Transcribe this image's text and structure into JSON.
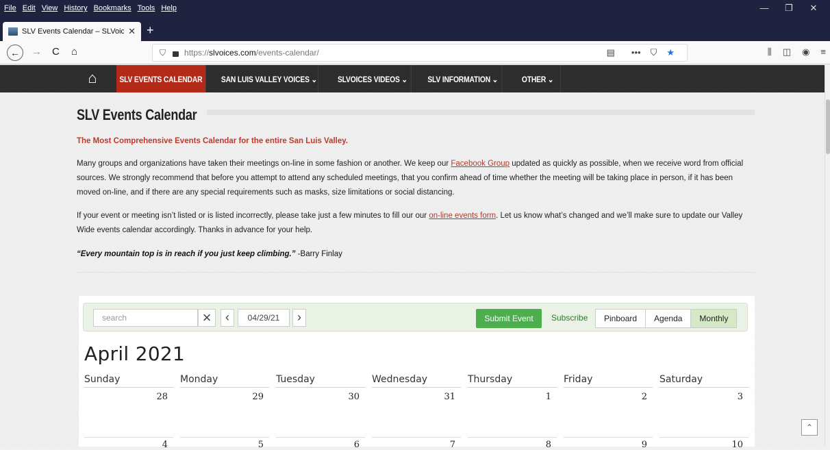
{
  "browser": {
    "menu": [
      "File",
      "Edit",
      "View",
      "History",
      "Bookmarks",
      "Tools",
      "Help"
    ],
    "window_controls": [
      "—",
      "❐",
      "✕"
    ],
    "tab_title": "SLV Events Calendar – SLVoices",
    "url_prefix": "https://",
    "url_host": "slvoices.com",
    "url_path": "/events-calendar/"
  },
  "site_nav": {
    "items": [
      "SLV EVENTS CALENDAR ⌄",
      "SAN LUIS VALLEY VOICES ⌄",
      "SLVOICES VIDEOS ⌄",
      "SLV INFORMATION ⌄",
      "OTHER ⌄"
    ]
  },
  "page": {
    "title": "SLV Events Calendar",
    "tagline": "The Most Comprehensive Events Calendar for the entire San Luis Valley.",
    "p1_a": "Many groups and organizations have taken their meetings on-line in some fashion or another. We keep our ",
    "p1_link": "Facebook Group",
    "p1_b": " updated as quickly as possible, when we receive word from official sources. We strongly recommend that before you attempt to attend any scheduled meetings, that you confirm ahead of time whether the meeting will be taking place in person, if it has been moved on-line, and if there are any special requirements such as masks, size limitations or social distancing.",
    "p2_a": "If your event or meeting isn’t listed or is listed incorrectly, please take just a few minutes to fill our our ",
    "p2_link": "on-line events form",
    "p2_b": ". Let us know what’s changed and we’ll make sure to update our Valley Wide events calendar accordingly. Thanks in advance for your help.",
    "quote": "“Every mountain top is in reach if you just keep climbing.”",
    "quote_author": " -Barry Finlay"
  },
  "calendar": {
    "search_placeholder": "search",
    "date_value": "04/29/21",
    "submit_label": "Submit Event",
    "subscribe_label": "Subscribe",
    "views": [
      "Pinboard",
      "Agenda",
      "Monthly"
    ],
    "active_view": "Monthly",
    "month_title": "April 2021",
    "weekdays": [
      "Sunday",
      "Monday",
      "Tuesday",
      "Wednesday",
      "Thursday",
      "Friday",
      "Saturday"
    ],
    "week1": [
      "28",
      "29",
      "30",
      "31",
      "1",
      "2",
      "3"
    ],
    "week2": [
      "4",
      "5",
      "6",
      "7",
      "8",
      "9",
      "10"
    ]
  }
}
